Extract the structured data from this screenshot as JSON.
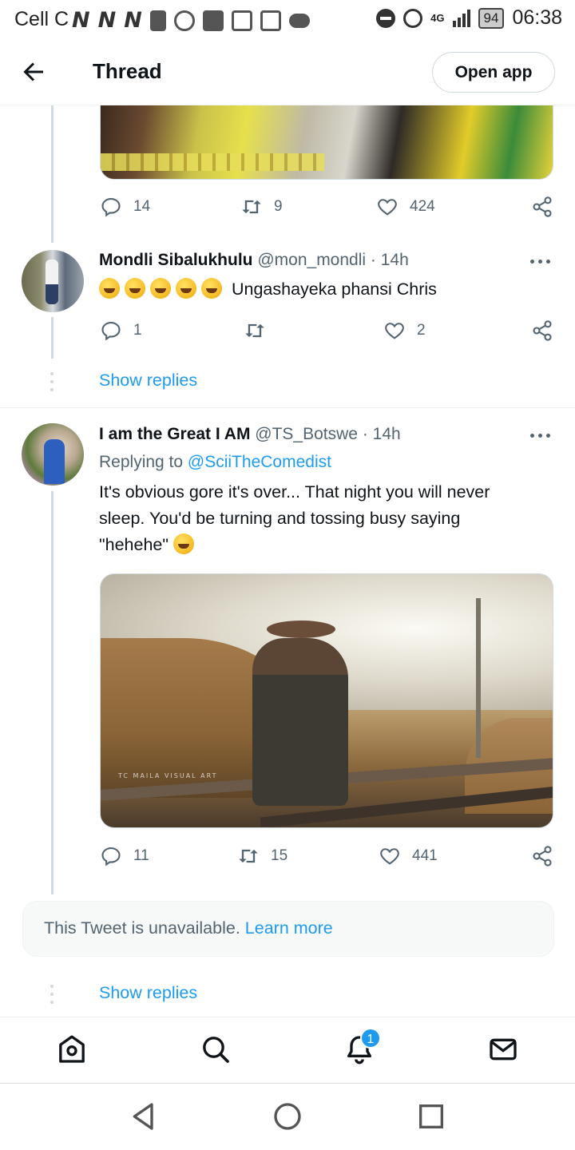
{
  "status_bar": {
    "carrier": "Cell C",
    "network": "4G",
    "battery": "94",
    "time": "06:38"
  },
  "header": {
    "title": "Thread",
    "open_app_label": "Open app"
  },
  "tweet0": {
    "replies": "14",
    "retweets": "9",
    "likes": "424"
  },
  "tweet1": {
    "name": "Mondli Sibalukhulu",
    "handle": "@mon_mondli",
    "separator": "·",
    "time": "14h",
    "text": "Ungashayeka phansi Chris",
    "emoji_count": 5,
    "replies": "1",
    "retweets": "",
    "likes": "2",
    "show_replies": "Show replies"
  },
  "tweet2": {
    "name": "I am the Great I AM",
    "handle": "@TS_Botswe",
    "separator": "·",
    "time": "14h",
    "replying_prefix": "Replying to",
    "replying_to": "@SciiTheComedist",
    "text_line1": "It's obvious gore it's over... That night you will never",
    "text_line2": "sleep. You'd be turning and tossing busy saying",
    "text_line3": "\"hehehe\"",
    "image_caption": "TC MAILA VISUAL ART",
    "replies": "11",
    "retweets": "15",
    "likes": "441"
  },
  "unavailable": {
    "text": "This Tweet is unavailable.",
    "link": "Learn more"
  },
  "show_replies_2": "Show replies",
  "bottom_nav": {
    "notification_badge": "1",
    "items": [
      "home-icon",
      "search-icon",
      "bell-icon",
      "mail-icon"
    ]
  },
  "colors": {
    "link": "#1d9bf0",
    "muted": "#536471",
    "text": "#0f1419"
  }
}
